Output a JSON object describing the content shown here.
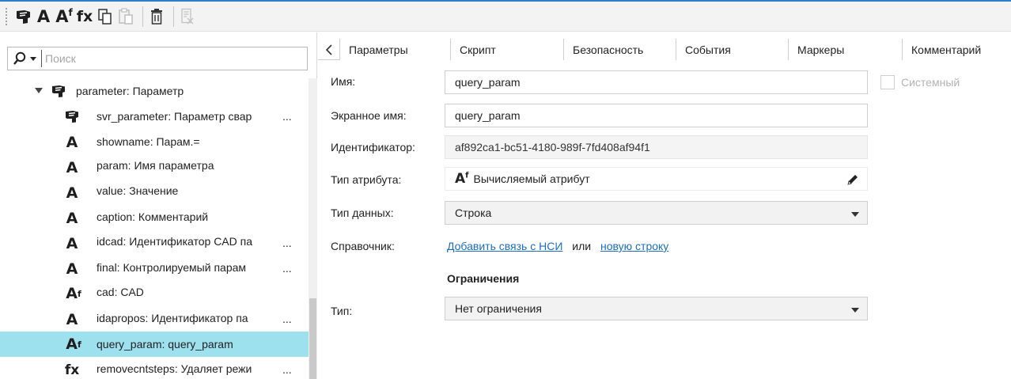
{
  "toolbar": {
    "items": [
      {
        "name": "add-object-icon"
      },
      {
        "name": "add-attribute-icon",
        "text": "A"
      },
      {
        "name": "add-computed-attribute-icon",
        "text": "A",
        "sup": "f"
      },
      {
        "name": "add-function-icon",
        "text": "fx"
      },
      {
        "name": "copy-icon"
      },
      {
        "name": "paste-icon"
      },
      {
        "name": "delete-icon"
      },
      {
        "name": "disabled-tool-icon"
      }
    ]
  },
  "search": {
    "placeholder": "Поиск",
    "value": ""
  },
  "tree": {
    "nodes": [
      {
        "icon": "object",
        "label": "parameter: Параметр",
        "expanded": true,
        "level": 0
      },
      {
        "icon": "object",
        "label": "svr_parameter: Параметр свар",
        "ellipsis": "...",
        "level": 1
      },
      {
        "icon": "A",
        "label": "showname: Парам.=",
        "level": 1
      },
      {
        "icon": "A",
        "label": "param: Имя параметра",
        "level": 1
      },
      {
        "icon": "A",
        "label": "value: Значение",
        "level": 1
      },
      {
        "icon": "A",
        "label": "caption: Комментарий",
        "level": 1
      },
      {
        "icon": "A",
        "label": "idcad: Идентификатор CAD па",
        "ellipsis": "...",
        "level": 1
      },
      {
        "icon": "A",
        "label": "final: Контролируемый парам",
        "ellipsis": "...",
        "level": 1
      },
      {
        "icon": "Af",
        "label": "cad: CAD",
        "level": 1
      },
      {
        "icon": "A",
        "label": "idapropos: Идентификатор па",
        "ellipsis": "...",
        "level": 1
      },
      {
        "icon": "Af",
        "label": "query_param: query_param",
        "selected": true,
        "level": 1
      },
      {
        "icon": "fx",
        "label": "removecntsteps: Удаляет режи",
        "ellipsis": "...",
        "level": 1
      }
    ]
  },
  "tabs": [
    {
      "label": "Параметры",
      "active": true
    },
    {
      "label": "Скрипт"
    },
    {
      "label": "Безопасность"
    },
    {
      "label": "События"
    },
    {
      "label": "Маркеры"
    },
    {
      "label": "Комментарий"
    }
  ],
  "form": {
    "name_label": "Имя:",
    "name_value": "query_param",
    "display_name_label": "Экранное имя:",
    "display_name_value": "query_param",
    "id_label": "Идентификатор:",
    "id_value": "af892ca1-bc51-4180-989f-7fd408af94f1",
    "attr_type_label": "Тип атрибута:",
    "attr_type_icon_text": "A",
    "attr_type_icon_sup": "f",
    "attr_type_value": "Вычисляемый атрибут",
    "data_type_label": "Тип данных:",
    "data_type_value": "Строка",
    "reference_label": "Справочник:",
    "reference_link_nsi": "Добавить связь с НСИ",
    "reference_or": "или",
    "reference_link_row": "новую строку",
    "restrictions_title": "Ограничения",
    "restriction_type_label": "Тип:",
    "restriction_type_value": "Нет ограничения",
    "system_label": "Системный",
    "system_checked": false
  },
  "colors": {
    "accent": "#2f7bcc",
    "selection": "#9de0ee",
    "link": "#1b6ec2"
  }
}
